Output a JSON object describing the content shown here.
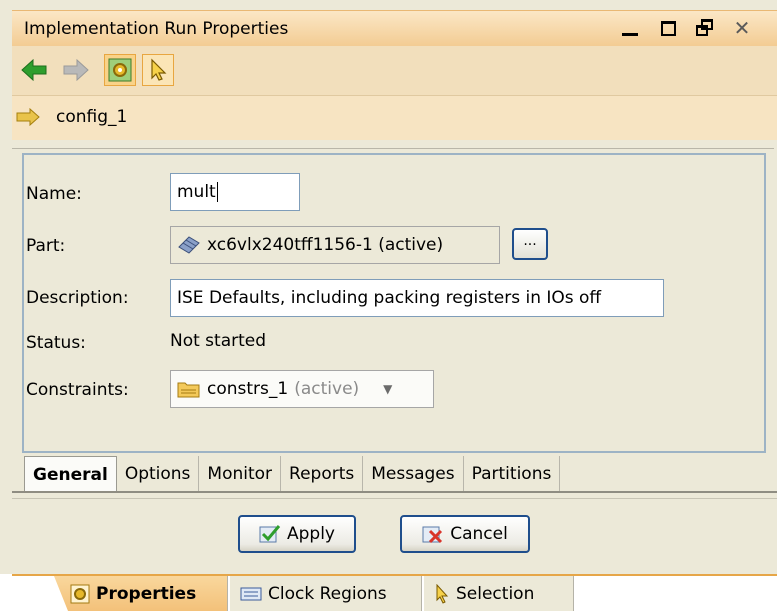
{
  "window": {
    "title": "Implementation Run Properties"
  },
  "toolbar": {
    "back_icon": "arrow-left-icon",
    "forward_icon": "arrow-right-icon",
    "settings_icon": "gear-icon",
    "pointer_icon": "pointer-icon"
  },
  "breadcrumb": {
    "label": "config_1"
  },
  "form": {
    "name_label": "Name:",
    "name_value": "mult",
    "part_label": "Part:",
    "part_value": "xc6vlx240tff1156-1 (active)",
    "ellipsis_label": "...",
    "description_label": "Description:",
    "description_value": "ISE Defaults, including packing registers in IOs off",
    "status_label": "Status:",
    "status_value": "Not started",
    "constraints_label": "Constraints:",
    "constraints_value": "constrs_1",
    "constraints_active": "(active)"
  },
  "tabs": [
    {
      "label": "General",
      "active": true
    },
    {
      "label": "Options"
    },
    {
      "label": "Monitor"
    },
    {
      "label": "Reports"
    },
    {
      "label": "Messages"
    },
    {
      "label": "Partitions"
    }
  ],
  "buttons": {
    "apply": "Apply",
    "cancel": "Cancel"
  },
  "bottom_tabs": {
    "properties": "Properties",
    "clock_regions": "Clock Regions",
    "selection": "Selection"
  },
  "colors": {
    "title_bg": "#f3cc93",
    "toolbar_bg": "#f2dfbc",
    "panel_bg": "#ece9d8",
    "button_border": "#1f4e8c"
  }
}
